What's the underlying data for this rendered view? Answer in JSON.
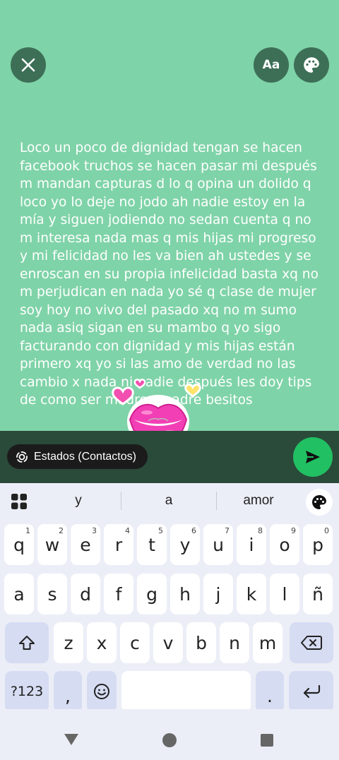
{
  "header": {
    "close_icon": "close-icon",
    "font_label": "Aa",
    "palette_icon": "palette-icon"
  },
  "status_text": "Loco un poco de dignidad tengan se hacen facebook truchos se hacen pasar mi después m mandan capturas d lo q opina un dolido q loco yo lo deje no jodo ah nadie estoy en la mía y siguen jodiendo no sedan cuenta q no m interesa nada mas q mis hijas mi progreso y mi felicidad no les va bien ah ustedes y se enroscan en su propia infelicidad basta xq no m perjudican en nada yo sé q clase de mujer soy hoy no vivo del pasado xq no m sumo nada asiq sigan en su mambo q yo sigo facturando con dignidad y mis hijas están primero xq yo si las amo de verdad no las cambio x nada ni nadie después les doy tips de como ser madre y padre besitos",
  "sticker": {
    "icon": "kiss-lips-sticker"
  },
  "bottom_bar": {
    "audience_label": "Estados (Contactos)",
    "send_icon": "send-icon"
  },
  "keyboard": {
    "suggestions": [
      "y",
      "a",
      "amor"
    ],
    "row1": [
      {
        "k": "q",
        "s": "1"
      },
      {
        "k": "w",
        "s": "2"
      },
      {
        "k": "e",
        "s": "3"
      },
      {
        "k": "r",
        "s": "4"
      },
      {
        "k": "t",
        "s": "5"
      },
      {
        "k": "y",
        "s": "6"
      },
      {
        "k": "u",
        "s": "7"
      },
      {
        "k": "i",
        "s": "8"
      },
      {
        "k": "o",
        "s": "9"
      },
      {
        "k": "p",
        "s": "0"
      }
    ],
    "row2": [
      "a",
      "s",
      "d",
      "f",
      "g",
      "h",
      "j",
      "k",
      "l",
      "ñ"
    ],
    "row3": [
      "z",
      "x",
      "c",
      "v",
      "b",
      "n",
      "m"
    ],
    "symbols_label": "?123",
    "comma": ",",
    "period": "."
  },
  "colors": {
    "background": "#7fd3a8",
    "button_dark": "#3d6f57",
    "send": "#21c063",
    "sticker_pink": "#f23fb5"
  }
}
